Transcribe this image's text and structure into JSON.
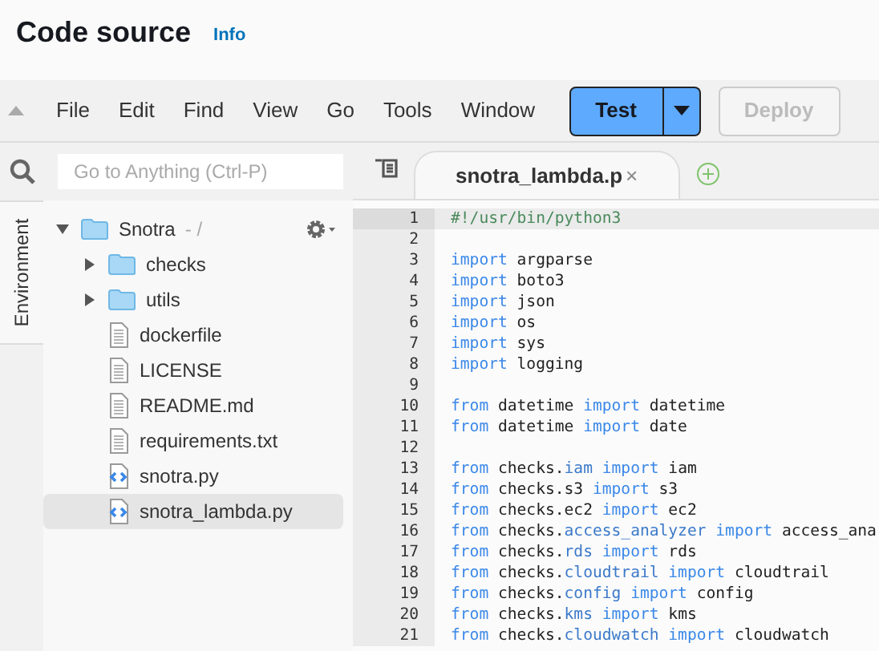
{
  "header": {
    "title": "Code source",
    "info_link": "Info"
  },
  "menu": [
    "File",
    "Edit",
    "Find",
    "View",
    "Go",
    "Tools",
    "Window"
  ],
  "buttons": {
    "test": {
      "label": "Test",
      "disabled": false
    },
    "deploy": {
      "label": "Deploy",
      "disabled": true
    }
  },
  "side_tabs": [
    {
      "label": "Environment",
      "selected": true
    }
  ],
  "search": {
    "placeholder": "Go to Anything (Ctrl-P)"
  },
  "tree": [
    {
      "kind": "folder",
      "name": "Snotra",
      "suffix": "- /",
      "expanded": true,
      "selected": false,
      "children": [
        {
          "kind": "folder",
          "name": "checks",
          "expanded": false,
          "selected": false
        },
        {
          "kind": "folder",
          "name": "utils",
          "expanded": false,
          "selected": false
        },
        {
          "kind": "doc",
          "name": "dockerfile",
          "selected": false
        },
        {
          "kind": "doc",
          "name": "LICENSE",
          "selected": false
        },
        {
          "kind": "doc",
          "name": "README.md",
          "selected": false
        },
        {
          "kind": "doc",
          "name": "requirements.txt",
          "selected": false
        },
        {
          "kind": "script",
          "name": "snotra.py",
          "selected": false
        },
        {
          "kind": "script",
          "name": "snotra_lambda.py",
          "selected": true
        }
      ]
    }
  ],
  "editor_tabs": [
    {
      "label": "snotra_lambda.p",
      "selected": true,
      "close": "×"
    }
  ],
  "code": [
    {
      "number": "1",
      "active": true,
      "tokens": [
        {
          "kind": "comment",
          "text": "#!/usr/bin/python3"
        }
      ]
    },
    {
      "number": "2",
      "active": false
    },
    {
      "number": "3",
      "active": false,
      "tokens": [
        {
          "kind": "keyword",
          "text": "import"
        },
        {
          "kind": "plain",
          "text": " argparse"
        }
      ]
    },
    {
      "number": "4",
      "active": false,
      "tokens": [
        {
          "kind": "keyword",
          "text": "import"
        },
        {
          "kind": "plain",
          "text": " boto3"
        }
      ]
    },
    {
      "number": "5",
      "active": false,
      "tokens": [
        {
          "kind": "keyword",
          "text": "import"
        },
        {
          "kind": "plain",
          "text": " json"
        }
      ]
    },
    {
      "number": "6",
      "active": false,
      "tokens": [
        {
          "kind": "keyword",
          "text": "import"
        },
        {
          "kind": "plain",
          "text": " os"
        }
      ]
    },
    {
      "number": "7",
      "active": false,
      "tokens": [
        {
          "kind": "keyword",
          "text": "import"
        },
        {
          "kind": "plain",
          "text": " sys"
        }
      ]
    },
    {
      "number": "8",
      "active": false,
      "tokens": [
        {
          "kind": "keyword",
          "text": "import"
        },
        {
          "kind": "plain",
          "text": " logging"
        }
      ]
    },
    {
      "number": "9",
      "active": false
    },
    {
      "number": "10",
      "active": false,
      "tokens": [
        {
          "kind": "keyword",
          "text": "from"
        },
        {
          "kind": "plain",
          "text": " datetime "
        },
        {
          "kind": "keyword",
          "text": "import"
        },
        {
          "kind": "plain",
          "text": " datetime"
        }
      ]
    },
    {
      "number": "11",
      "active": false,
      "tokens": [
        {
          "kind": "keyword",
          "text": "from"
        },
        {
          "kind": "plain",
          "text": " datetime "
        },
        {
          "kind": "keyword",
          "text": "import"
        },
        {
          "kind": "plain",
          "text": " date"
        }
      ]
    },
    {
      "number": "12",
      "active": false
    },
    {
      "number": "13",
      "active": false,
      "tokens": [
        {
          "kind": "keyword",
          "text": "from"
        },
        {
          "kind": "plain",
          "text": " checks."
        },
        {
          "kind": "attr",
          "text": "iam"
        },
        {
          "kind": "keyword",
          "text": " import"
        },
        {
          "kind": "plain",
          "text": " iam"
        }
      ]
    },
    {
      "number": "14",
      "active": false,
      "tokens": [
        {
          "kind": "keyword",
          "text": "from"
        },
        {
          "kind": "plain",
          "text": " checks.s3 "
        },
        {
          "kind": "keyword",
          "text": "import"
        },
        {
          "kind": "plain",
          "text": " s3"
        }
      ]
    },
    {
      "number": "15",
      "active": false,
      "tokens": [
        {
          "kind": "keyword",
          "text": "from"
        },
        {
          "kind": "plain",
          "text": " checks.ec2 "
        },
        {
          "kind": "keyword",
          "text": "import"
        },
        {
          "kind": "plain",
          "text": " ec2"
        }
      ]
    },
    {
      "number": "16",
      "active": false,
      "tokens": [
        {
          "kind": "keyword",
          "text": "from"
        },
        {
          "kind": "plain",
          "text": " checks."
        },
        {
          "kind": "attr",
          "text": "access_analyzer"
        },
        {
          "kind": "keyword",
          "text": " import"
        },
        {
          "kind": "plain",
          "text": " access_ana"
        }
      ]
    },
    {
      "number": "17",
      "active": false,
      "tokens": [
        {
          "kind": "keyword",
          "text": "from"
        },
        {
          "kind": "plain",
          "text": " checks."
        },
        {
          "kind": "attr",
          "text": "rds"
        },
        {
          "kind": "keyword",
          "text": " import"
        },
        {
          "kind": "plain",
          "text": " rds"
        }
      ]
    },
    {
      "number": "18",
      "active": false,
      "tokens": [
        {
          "kind": "keyword",
          "text": "from"
        },
        {
          "kind": "plain",
          "text": " checks."
        },
        {
          "kind": "attr",
          "text": "cloudtrail"
        },
        {
          "kind": "keyword",
          "text": " import"
        },
        {
          "kind": "plain",
          "text": " cloudtrail"
        }
      ]
    },
    {
      "number": "19",
      "active": false,
      "tokens": [
        {
          "kind": "keyword",
          "text": "from"
        },
        {
          "kind": "plain",
          "text": " checks."
        },
        {
          "kind": "attr",
          "text": "config"
        },
        {
          "kind": "keyword",
          "text": " import"
        },
        {
          "kind": "plain",
          "text": " config"
        }
      ]
    },
    {
      "number": "20",
      "active": false,
      "tokens": [
        {
          "kind": "keyword",
          "text": "from"
        },
        {
          "kind": "plain",
          "text": " checks."
        },
        {
          "kind": "attr",
          "text": "kms"
        },
        {
          "kind": "keyword",
          "text": " import"
        },
        {
          "kind": "plain",
          "text": " kms"
        }
      ]
    },
    {
      "number": "21",
      "active": false,
      "tokens": [
        {
          "kind": "keyword",
          "text": "from"
        },
        {
          "kind": "plain",
          "text": " checks."
        },
        {
          "kind": "attr",
          "text": "cloudwatch"
        },
        {
          "kind": "keyword",
          "text": " import"
        },
        {
          "kind": "plain",
          "text": " cloudwatch"
        }
      ]
    }
  ]
}
